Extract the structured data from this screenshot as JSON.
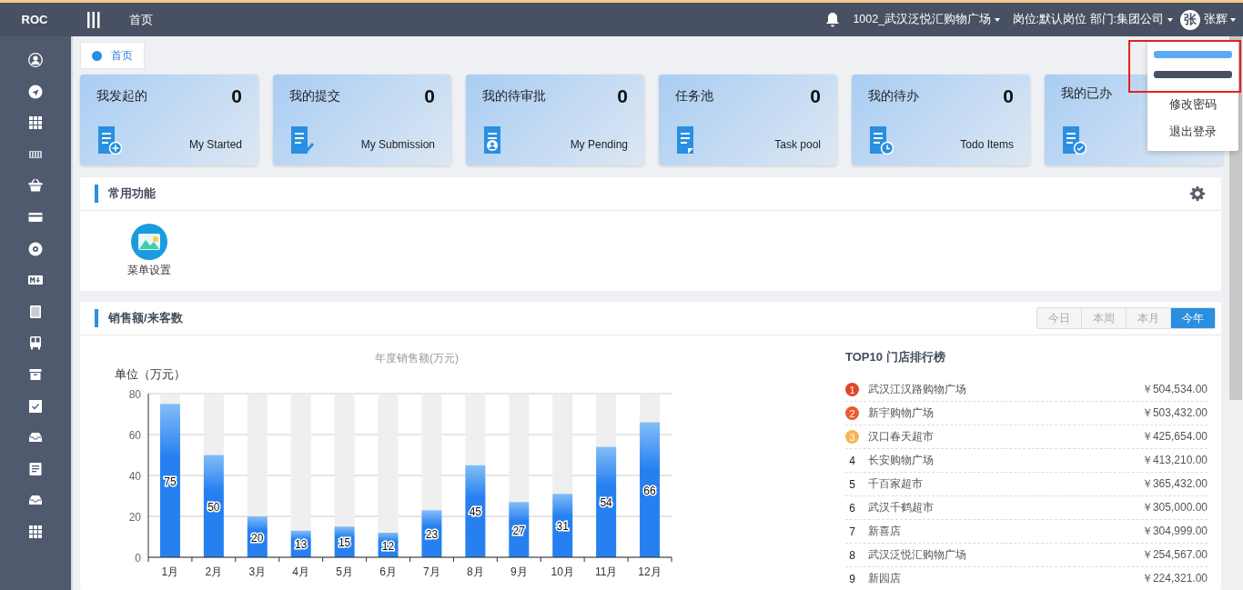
{
  "topbar": {
    "logo": "ROC",
    "home_link": "首页",
    "store": "1002_武汉泛悦汇购物广场",
    "position": "岗位:默认岗位 部门:集团公司",
    "avatar": "张",
    "user": "张辉"
  },
  "user_menu": [
    {
      "kind": "redacted",
      "color": "#5aabf5"
    },
    {
      "kind": "redacted",
      "color": "#485163"
    },
    {
      "kind": "text",
      "label": "修改密码"
    },
    {
      "kind": "text",
      "label": "退出登录"
    }
  ],
  "tabs": [
    {
      "label": "首页",
      "selected": true
    }
  ],
  "cards": [
    {
      "title": "我发起的",
      "count": "0",
      "label": "My Started"
    },
    {
      "title": "我的提交",
      "count": "0",
      "label": "My Submission"
    },
    {
      "title": "我的待审批",
      "count": "0",
      "label": "My Pending"
    },
    {
      "title": "任务池",
      "count": "0",
      "label": "Task pool"
    },
    {
      "title": "我的待办",
      "count": "0",
      "label": "Todo Items"
    },
    {
      "title": "我的已办"
    }
  ],
  "common_functions": {
    "title": "常用功能",
    "items": [
      {
        "label": "菜单设置"
      }
    ]
  },
  "sales": {
    "title": "销售额/来客数",
    "periods": [
      {
        "label": "今日",
        "selected": false
      },
      {
        "label": "本周",
        "selected": false
      },
      {
        "label": "本月",
        "selected": false
      },
      {
        "label": "今年",
        "selected": true
      }
    ],
    "chart_data": {
      "type": "bar",
      "title": "年度销售额(万元)",
      "ylabel": "单位（万元）",
      "categories": [
        "1月",
        "2月",
        "3月",
        "4月",
        "5月",
        "6月",
        "7月",
        "8月",
        "9月",
        "10月",
        "11月",
        "12月"
      ],
      "series": [
        {
          "color": "#2680f0",
          "values": [
            75,
            50,
            20,
            13,
            15,
            12,
            23,
            45,
            27,
            31,
            54,
            66
          ]
        },
        {
          "color": "#efefef",
          "values": [
            5,
            30,
            60,
            67,
            65,
            68,
            57,
            35,
            53,
            49,
            26,
            14
          ]
        }
      ],
      "stacked": true,
      "ylim": [
        0,
        80
      ],
      "yticks": [
        0,
        20,
        40,
        60,
        80
      ],
      "grid": true,
      "value_labels": [
        [
          "75",
          "50",
          "20",
          "13",
          "15",
          "12",
          "23",
          "45",
          "27",
          "31",
          "54",
          "66"
        ],
        [
          null,
          null,
          null,
          null,
          null,
          null,
          null,
          null,
          null,
          null,
          null,
          null
        ]
      ]
    },
    "ranking": {
      "title": "TOP10 门店排行榜",
      "rows": [
        {
          "rank": "1",
          "name": "武汉江汉路购物广场",
          "amount": "￥504,534.00",
          "color": "#e0472a"
        },
        {
          "rank": "2",
          "name": "新宇购物广场",
          "amount": "￥503,432.00",
          "color": "#ee5a2f"
        },
        {
          "rank": "3",
          "name": "汉口春天超市",
          "amount": "￥425,654.00",
          "color": "#f7b450"
        },
        {
          "rank": "4",
          "name": "长安购物广场",
          "amount": "￥413,210.00"
        },
        {
          "rank": "5",
          "name": "千百家超市",
          "amount": "￥365,432.00"
        },
        {
          "rank": "6",
          "name": "武汉千鹤超市",
          "amount": "￥305,000.00"
        },
        {
          "rank": "7",
          "name": "新喜店",
          "amount": "￥304,999.00"
        },
        {
          "rank": "8",
          "name": "武汉泛悦汇购物广场",
          "amount": "￥254,567.00"
        },
        {
          "rank": "9",
          "name": "新园店",
          "amount": "￥224,321.00"
        }
      ]
    }
  }
}
